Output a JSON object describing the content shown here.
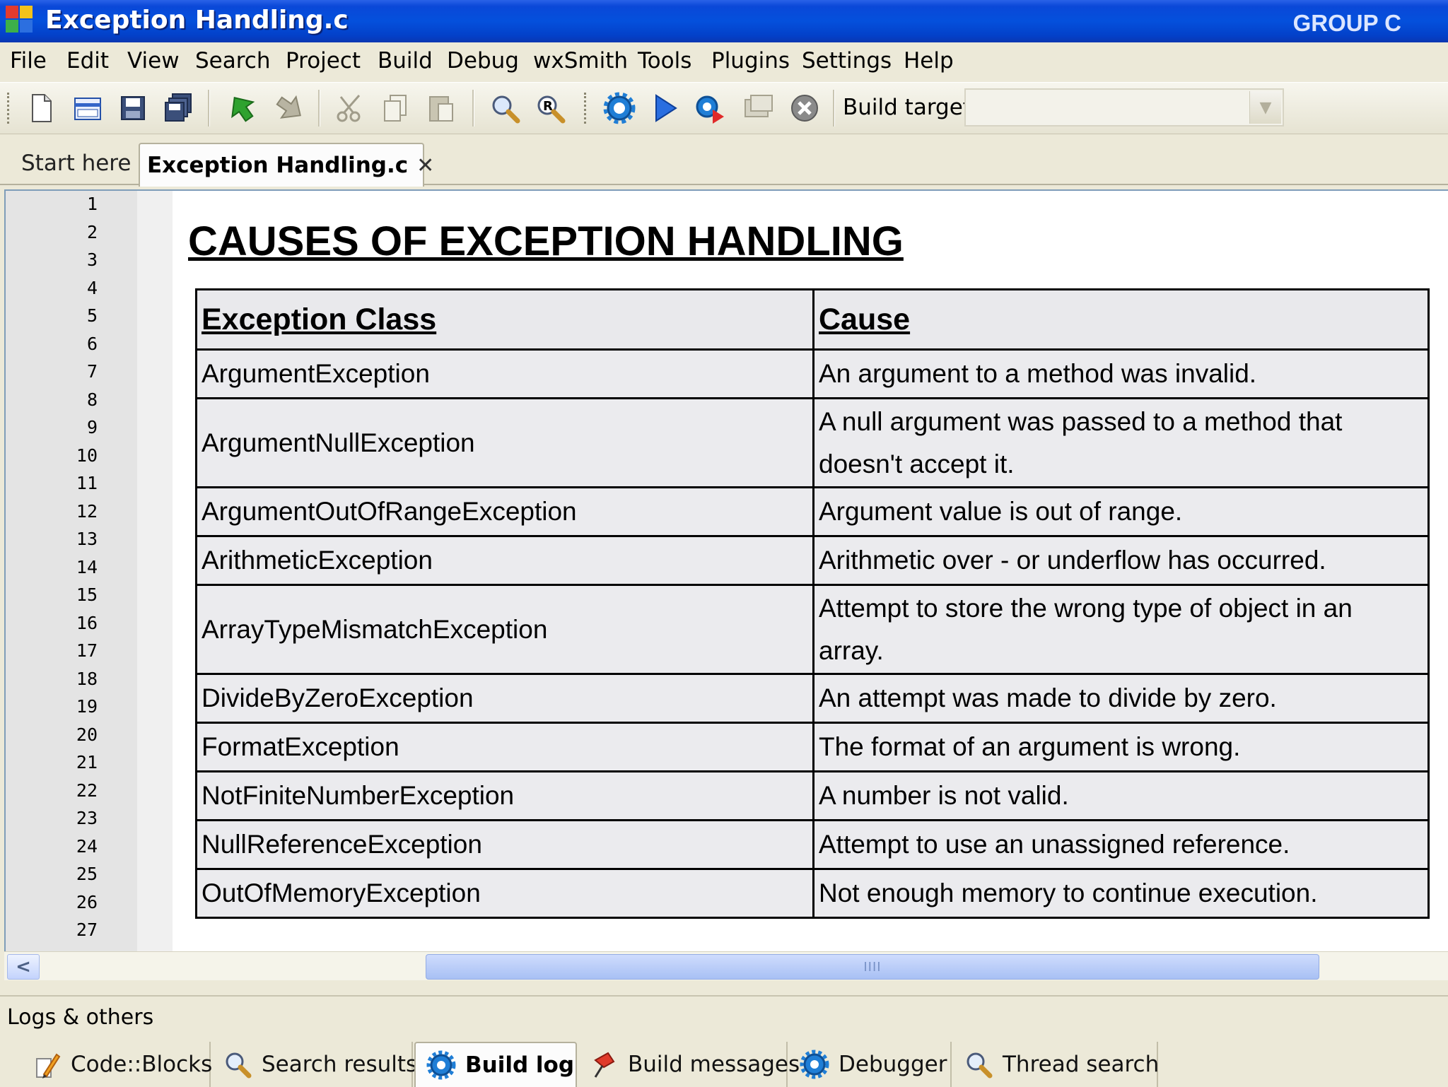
{
  "window": {
    "title": "Exception Handling.c",
    "group_label": "GROUP C"
  },
  "menu": [
    "File",
    "Edit",
    "View",
    "Search",
    "Project",
    "Build",
    "Debug",
    "wxSmith",
    "Tools",
    "Plugins",
    "Settings",
    "Help"
  ],
  "toolbar": {
    "build_target_label": "Build target:",
    "build_target_value": ""
  },
  "tabs": [
    {
      "label": "Start here"
    },
    {
      "label": "Exception Handling.c",
      "close": "✕"
    }
  ],
  "editor": {
    "line_numbers": [
      "1",
      "2",
      "3",
      "4",
      "5",
      "6",
      "7",
      "8",
      "9",
      "10",
      "11",
      "12",
      "13",
      "14",
      "15",
      "16",
      "17",
      "18",
      "19",
      "20",
      "21",
      "22",
      "23",
      "24",
      "25",
      "26",
      "27"
    ],
    "title": "CAUSES OF EXCEPTION HANDLING",
    "table": {
      "headers": [
        "Exception Class",
        "Cause"
      ],
      "rows": [
        [
          "ArgumentException",
          "An argument to a method was invalid."
        ],
        [
          "ArgumentNullException",
          "A null argument was passed to a method that doesn't accept it."
        ],
        [
          "ArgumentOutOfRangeException",
          "Argument value is out of range."
        ],
        [
          "ArithmeticException",
          "Arithmetic over - or underflow has occurred."
        ],
        [
          "ArrayTypeMismatchException",
          "Attempt to store the wrong type of object in an array."
        ],
        [
          "DivideByZeroException",
          "An attempt was made to divide by zero."
        ],
        [
          "FormatException",
          "The format of an argument is wrong."
        ],
        [
          "NotFiniteNumberException",
          "A number is not valid."
        ],
        [
          "NullReferenceException",
          "Attempt to use an unassigned reference."
        ],
        [
          "OutOfMemoryException",
          "Not enough memory to continue execution."
        ]
      ]
    }
  },
  "scrollbar": {
    "left_arrow": "<",
    "thumb_grip": "IIII"
  },
  "logs": {
    "title": "Logs & others",
    "tabs": [
      {
        "label": "Code::Blocks",
        "icon": "pencil-icon"
      },
      {
        "label": "Search results",
        "icon": "magnifier-icon"
      },
      {
        "label": "Build log",
        "icon": "gear-icon",
        "active": true
      },
      {
        "label": "Build messages",
        "icon": "pushpin-icon"
      },
      {
        "label": "Debugger",
        "icon": "gear-icon"
      },
      {
        "label": "Thread search",
        "icon": "magnifier-icon"
      }
    ]
  },
  "colors": {
    "titlebar": "#0450dc",
    "face": "#ece9d8",
    "accent": "#2a62e8"
  }
}
